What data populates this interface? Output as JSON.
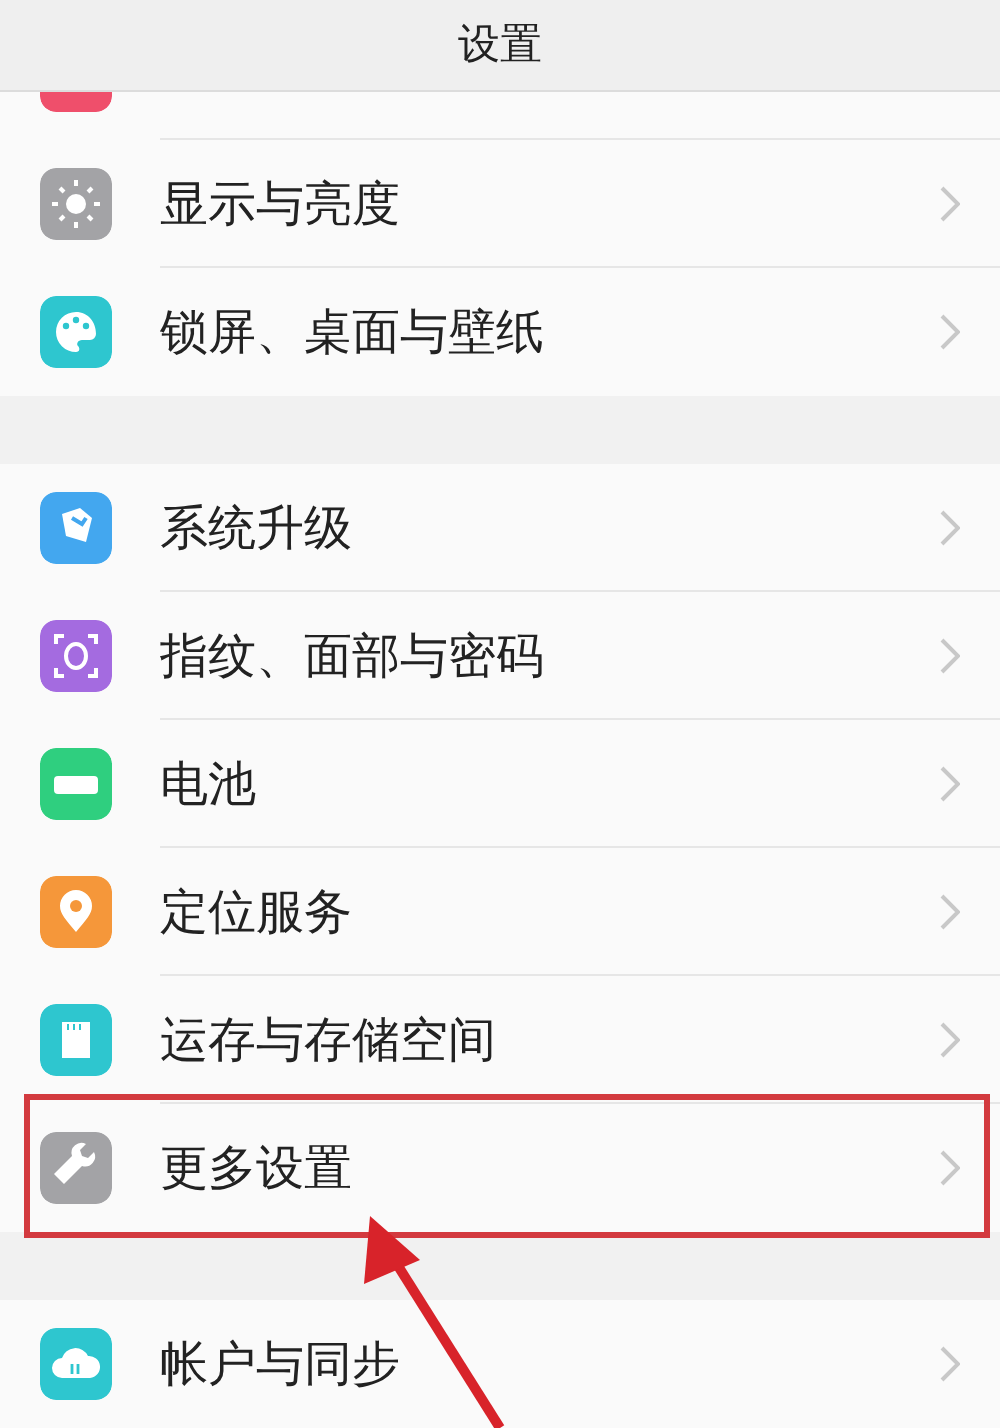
{
  "header": {
    "title": "设置"
  },
  "groups": [
    {
      "items": [
        {
          "kind": "sound",
          "clipped": true
        },
        {
          "kind": "display",
          "label": "显示与亮度",
          "highlighted": false
        },
        {
          "kind": "wallpaper",
          "label": "锁屏、桌面与壁纸",
          "highlighted": false
        }
      ]
    },
    {
      "items": [
        {
          "kind": "update",
          "label": "系统升级",
          "highlighted": false
        },
        {
          "kind": "fingerprint",
          "label": "指纹、面部与密码",
          "highlighted": false
        },
        {
          "kind": "battery",
          "label": "电池",
          "highlighted": false
        },
        {
          "kind": "location",
          "label": "定位服务",
          "highlighted": false
        },
        {
          "kind": "storage",
          "label": "运存与存储空间",
          "highlighted": false
        },
        {
          "kind": "tools",
          "label": "更多设置",
          "highlighted": true
        }
      ]
    },
    {
      "items": [
        {
          "kind": "cloud",
          "label": "帐户与同步",
          "highlighted": false
        }
      ]
    }
  ]
}
